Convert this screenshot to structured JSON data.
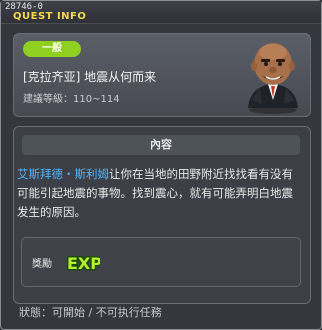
{
  "window": {
    "quest_id": "28746-0",
    "title": "QUEST INFO"
  },
  "quest": {
    "category": "一般",
    "name": "[克拉齐亚] 地震从何而来",
    "level_range": "建議等級：110~114"
  },
  "content": {
    "header": "內容",
    "npc_name": "艾斯拜德・斯利姆",
    "desc_rest": "让你在当地的田野附近找找看有没有可能引起地震的事物。找到震心，就有可能弄明白地震发生的原因。"
  },
  "reward": {
    "label": "獎勵",
    "icon": "exp-icon",
    "icon_text": "EXP"
  },
  "status": "狀態：可開始 / 不可执行任務",
  "colors": {
    "title": "#f4d84a",
    "badge": "#8fcf1f",
    "npc_name": "#4fb6ff"
  }
}
